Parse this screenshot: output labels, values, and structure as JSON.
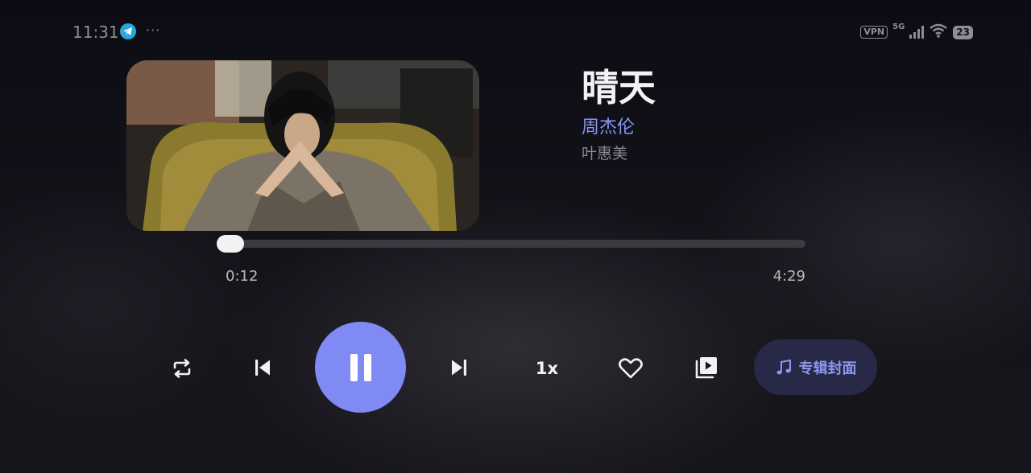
{
  "status_bar": {
    "time": "11:31",
    "notification_icons": [
      "telegram-icon",
      "more-dots-icon"
    ],
    "vpn_label": "VPN",
    "network_label": "5G",
    "battery": "23"
  },
  "song": {
    "title": "晴天",
    "artist": "周杰伦",
    "lyricist": "叶惠美"
  },
  "progress": {
    "current": "0:12",
    "total": "4:29",
    "fraction": 0.045
  },
  "controls": {
    "speed_label": "1x",
    "album_cover_label": "专辑封面",
    "icons": [
      "repeat-icon",
      "previous-icon",
      "pause-icon",
      "next-icon",
      "heart-icon",
      "playlist-icon",
      "music-note-icon"
    ]
  },
  "colors": {
    "accent": "#7f8af4",
    "artist_text": "#8796f6",
    "pill_bg": "#272947",
    "background": "#101018"
  }
}
